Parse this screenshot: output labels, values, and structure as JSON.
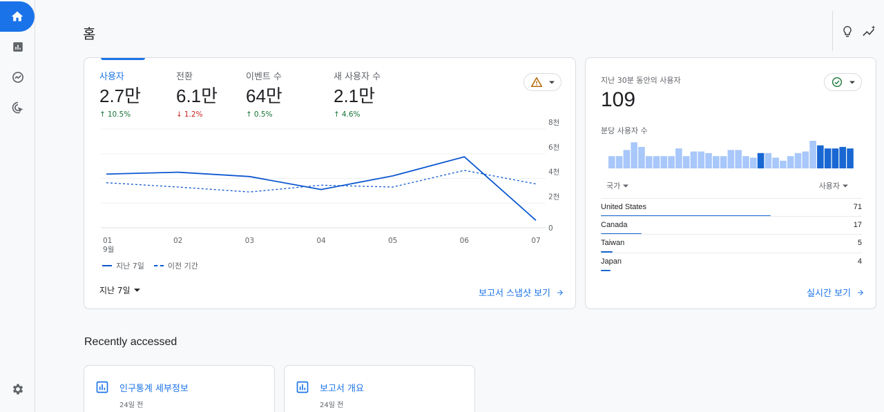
{
  "page": {
    "title": "홈"
  },
  "nav": {
    "items": [
      {
        "name": "home",
        "icon": "home-icon",
        "active": true
      },
      {
        "name": "reports",
        "icon": "bar-chart-icon"
      },
      {
        "name": "explore",
        "icon": "explore-icon"
      },
      {
        "name": "advertising",
        "icon": "cursor-target-icon"
      }
    ],
    "settings_icon": "gear-icon"
  },
  "top_actions": {
    "insights_icon": "lightbulb-icon",
    "trends_icon": "sparkline-icon"
  },
  "overview": {
    "metrics": [
      {
        "label": "사용자",
        "value": "2.7만",
        "delta": "10.5%",
        "direction": "up",
        "active": true
      },
      {
        "label": "전환",
        "value": "6.1만",
        "delta": "1.2%",
        "direction": "down"
      },
      {
        "label": "이벤트 수",
        "value": "64만",
        "delta": "0.5%",
        "direction": "up"
      },
      {
        "label": "새 사용자 수",
        "value": "2.1만",
        "delta": "4.6%",
        "direction": "up"
      }
    ],
    "warning_icon": "warning-icon",
    "legend": {
      "current": "지난 7일",
      "previous": "이전 기간"
    },
    "date_range": "지난 7일",
    "link": "보고서 스냅샷 보기"
  },
  "chart_data": {
    "type": "line",
    "x": [
      "01",
      "02",
      "03",
      "04",
      "05",
      "06",
      "07"
    ],
    "x_sublabel": "9월",
    "y_ticks": [
      {
        "value": 0,
        "label": "0"
      },
      {
        "value": 2000,
        "label": "2천"
      },
      {
        "value": 4000,
        "label": "4천"
      },
      {
        "value": 6000,
        "label": "6천"
      },
      {
        "value": 8000,
        "label": "8천"
      }
    ],
    "ylim": [
      0,
      8000
    ],
    "grid": true,
    "legend_position": "bottom-left",
    "series": [
      {
        "name": "지난 7일",
        "style": "solid",
        "color": "#0b57d0",
        "values": [
          4350,
          4500,
          4150,
          3100,
          4200,
          5750,
          600
        ]
      },
      {
        "name": "이전 기간",
        "style": "dashed",
        "color": "#0b57d0",
        "values": [
          3650,
          3300,
          2900,
          3450,
          3300,
          4650,
          3550
        ]
      }
    ]
  },
  "realtime": {
    "label": "지난 30분 동안의 사용자",
    "value": "109",
    "status_icon": "check-circle-icon",
    "per_minute_label": "분당 사용자 수",
    "per_minute": [
      8,
      8,
      12,
      17,
      14,
      8,
      8,
      8,
      8,
      13,
      8,
      11,
      11,
      10,
      8,
      8,
      12,
      12,
      8,
      7,
      10,
      10,
      7,
      5,
      8,
      10,
      11,
      18,
      15,
      13,
      13,
      14,
      13
    ],
    "per_minute_highlight_from": 28,
    "table_headers": {
      "country": "국가",
      "users": "사용자"
    },
    "rows": [
      {
        "country": "United States",
        "users": "71",
        "share": 1.0
      },
      {
        "country": "Canada",
        "users": "17",
        "share": 0.24
      },
      {
        "country": "Taiwan",
        "users": "5",
        "share": 0.07
      },
      {
        "country": "Japan",
        "users": "4",
        "share": 0.056
      }
    ],
    "link": "실시간 보기"
  },
  "recent": {
    "title": "Recently accessed",
    "cards": [
      {
        "title": "인구통계 세부정보",
        "time": "24일 전",
        "icon": "report-icon"
      },
      {
        "title": "보고서 개요",
        "time": "24일 전",
        "icon": "report-icon"
      }
    ]
  },
  "colors": {
    "accent": "#1a73e8",
    "up": "#137333",
    "down": "#c5221f",
    "bar_light": "#a8c7fa",
    "bar_dark": "#1967d2",
    "warning": "#b06000"
  }
}
